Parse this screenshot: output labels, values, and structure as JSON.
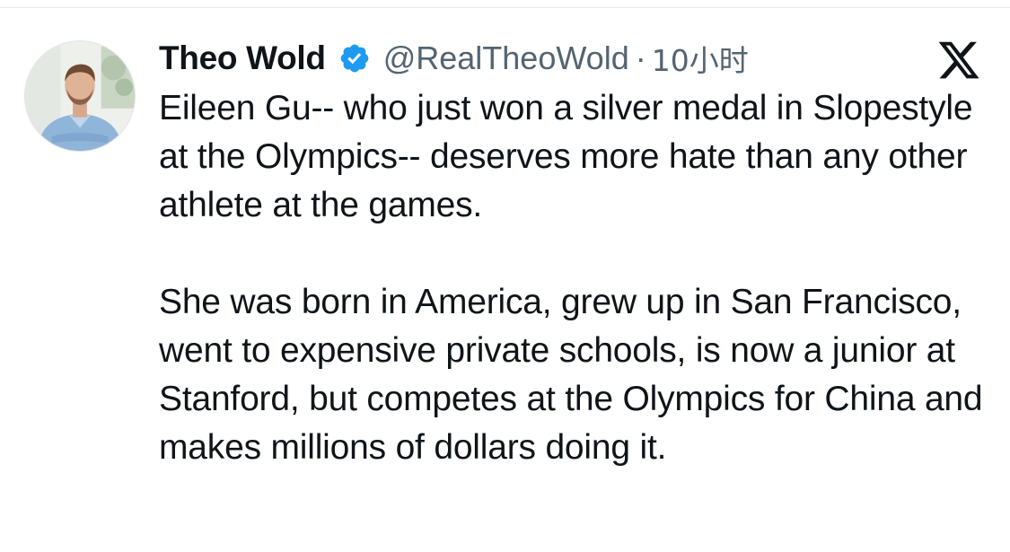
{
  "tweet": {
    "author": {
      "display_name": "Theo Wold",
      "handle": "@RealTheoWold",
      "verified_icon": "verified-badge-icon",
      "verified_color": "#1d9bf0"
    },
    "separator": "·",
    "timestamp": "10小时",
    "platform_logo": "x-logo-icon",
    "paragraphs": [
      "Eileen Gu-- who just won a silver medal in Slopestyle at the Olympics-- deserves more hate than any other athlete at the games.",
      "She was born in America, grew up in San Francisco, went to expensive private schools, is now a junior at Stanford, but competes at the Olympics for China and makes millions of dollars doing it."
    ]
  },
  "colors": {
    "text_primary": "#0f1419",
    "text_secondary": "#536471",
    "accent": "#1d9bf0"
  }
}
